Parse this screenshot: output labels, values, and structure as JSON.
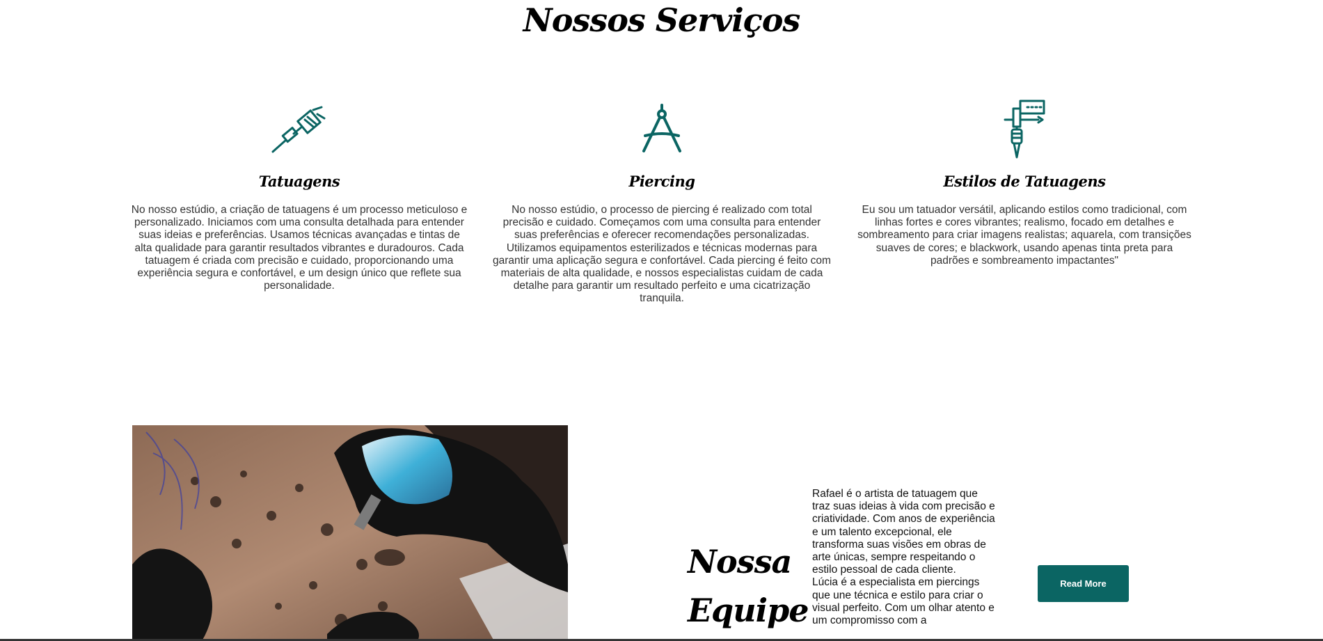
{
  "services": {
    "title": "Nossos Serviços",
    "items": [
      {
        "icon": "tattoo-machine-icon",
        "title": "Tatuagens",
        "description": "No nosso estúdio, a criação de tatuagens é um processo meticuloso e personalizado. Iniciamos com uma consulta detalhada para entender suas ideias e preferências. Usamos técnicas avançadas e tintas de alta qualidade para garantir resultados vibrantes e duradouros. Cada tatuagem é criada com precisão e cuidado, proporcionando uma experiência segura e confortável, e um design único que reflete sua personalidade."
      },
      {
        "icon": "compass-icon",
        "title": "Piercing",
        "description": "No nosso estúdio, o processo de piercing é realizado com total precisão e cuidado. Começamos com uma consulta para entender suas preferências e oferecer recomendações personalizadas. Utilizamos equipamentos esterilizados e técnicas modernas para garantir uma aplicação segura e confortável. Cada piercing é feito com materiais de alta qualidade, e nossos especialistas cuidam de cada detalhe para garantir um resultado perfeito e uma cicatrização tranquila."
      },
      {
        "icon": "tattoo-gun-vertical-icon",
        "title": "Estilos de Tatuagens",
        "description": "Eu sou um tatuador versátil, aplicando estilos como tradicional, com linhas fortes e cores vibrantes; realismo, focado em detalhes e sombreamento para criar imagens realistas; aquarela, com transições suaves de cores; e blackwork, usando apenas tinta preta para padrões e sombreamento impactantes\""
      }
    ]
  },
  "team": {
    "title_line1": "Nossa",
    "title_line2": "Equipe",
    "paragraph1": "Rafael é o artista de tatuagem que traz suas ideias à vida com precisão e criatividade. Com anos de experiência e um talento excepcional, ele transforma suas visões em obras de arte únicas, sempre respeitando o estilo pessoal de cada cliente.",
    "paragraph2": "Lúcia é a especialista em piercings que une técnica e estilo para criar o visual perfeito. Com um olhar atento e um compromisso com a",
    "read_more_label": "Read More"
  },
  "colors": {
    "accent": "#0b6563",
    "text": "#333333",
    "heading": "#000000"
  }
}
